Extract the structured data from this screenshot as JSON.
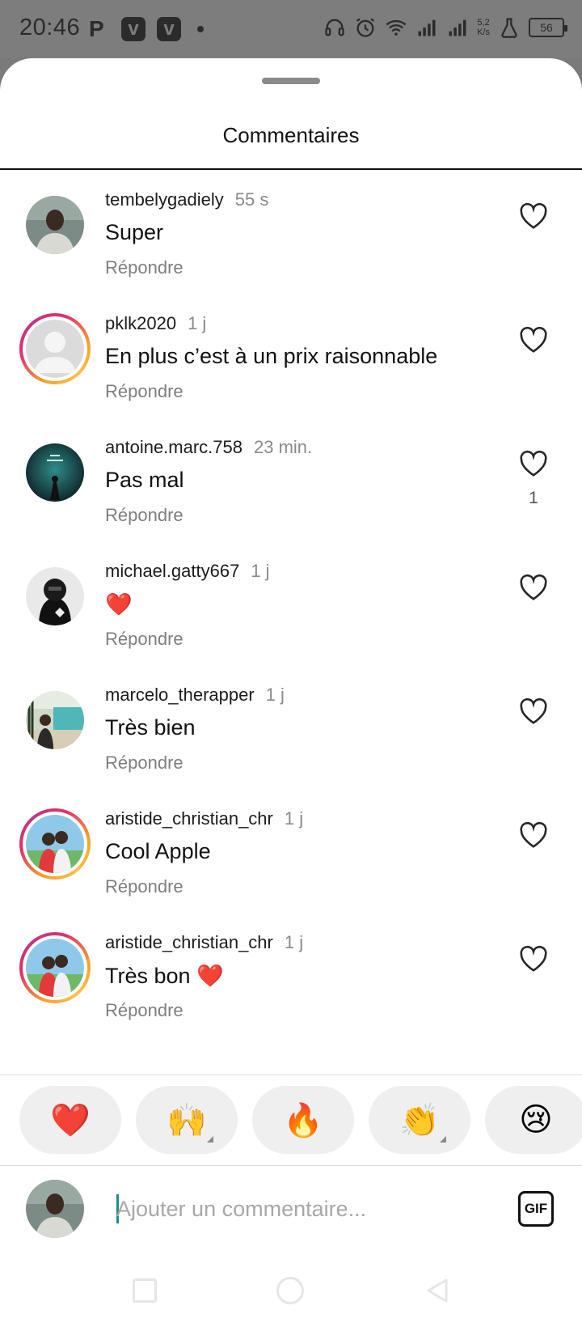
{
  "status_bar": {
    "time": "20:46",
    "left_icons": [
      "p-icon",
      "v-app-icon",
      "v-app-icon"
    ],
    "net_speed_value": "5,2",
    "net_speed_unit": "K/s",
    "battery": "56"
  },
  "sheet": {
    "title": "Commentaires"
  },
  "comments": [
    {
      "user": "tembelygadiely",
      "time": "55 s",
      "text": "Super",
      "reply": "Répondre",
      "likes": "",
      "ring": false
    },
    {
      "user": "pklk2020",
      "time": "1 j",
      "text": "En plus c’est à un prix raisonnable",
      "reply": "Répondre",
      "likes": "",
      "ring": true
    },
    {
      "user": "antoine.marc.758",
      "time": "23 min.",
      "text": "Pas mal",
      "reply": "Répondre",
      "likes": "1",
      "ring": false
    },
    {
      "user": "michael.gatty667",
      "time": "1 j",
      "text": "❤️",
      "reply": "Répondre",
      "likes": "",
      "ring": false
    },
    {
      "user": "marcelo_therapper",
      "time": "1 j",
      "text": "Très bien",
      "reply": "Répondre",
      "likes": "",
      "ring": false
    },
    {
      "user": "aristide_christian_chr",
      "time": "1 j",
      "text": "Cool Apple",
      "reply": "Répondre",
      "likes": "",
      "ring": true
    },
    {
      "user": "aristide_christian_chr",
      "time": "1 j",
      "text": "Très bon ❤️",
      "reply": "Répondre",
      "likes": "",
      "ring": true
    }
  ],
  "reactions": [
    "❤️",
    "🙌",
    "🔥",
    "👏",
    "😢"
  ],
  "composer": {
    "placeholder": "Ajouter un commentaire...",
    "gif_label": "GIF"
  },
  "colors": {
    "status_bar": "#7d7d7d",
    "like_heart": "#262626",
    "story_ring_start": "#f7a02b",
    "story_ring_end": "#c13584",
    "cursor": "#1b8c8c"
  }
}
